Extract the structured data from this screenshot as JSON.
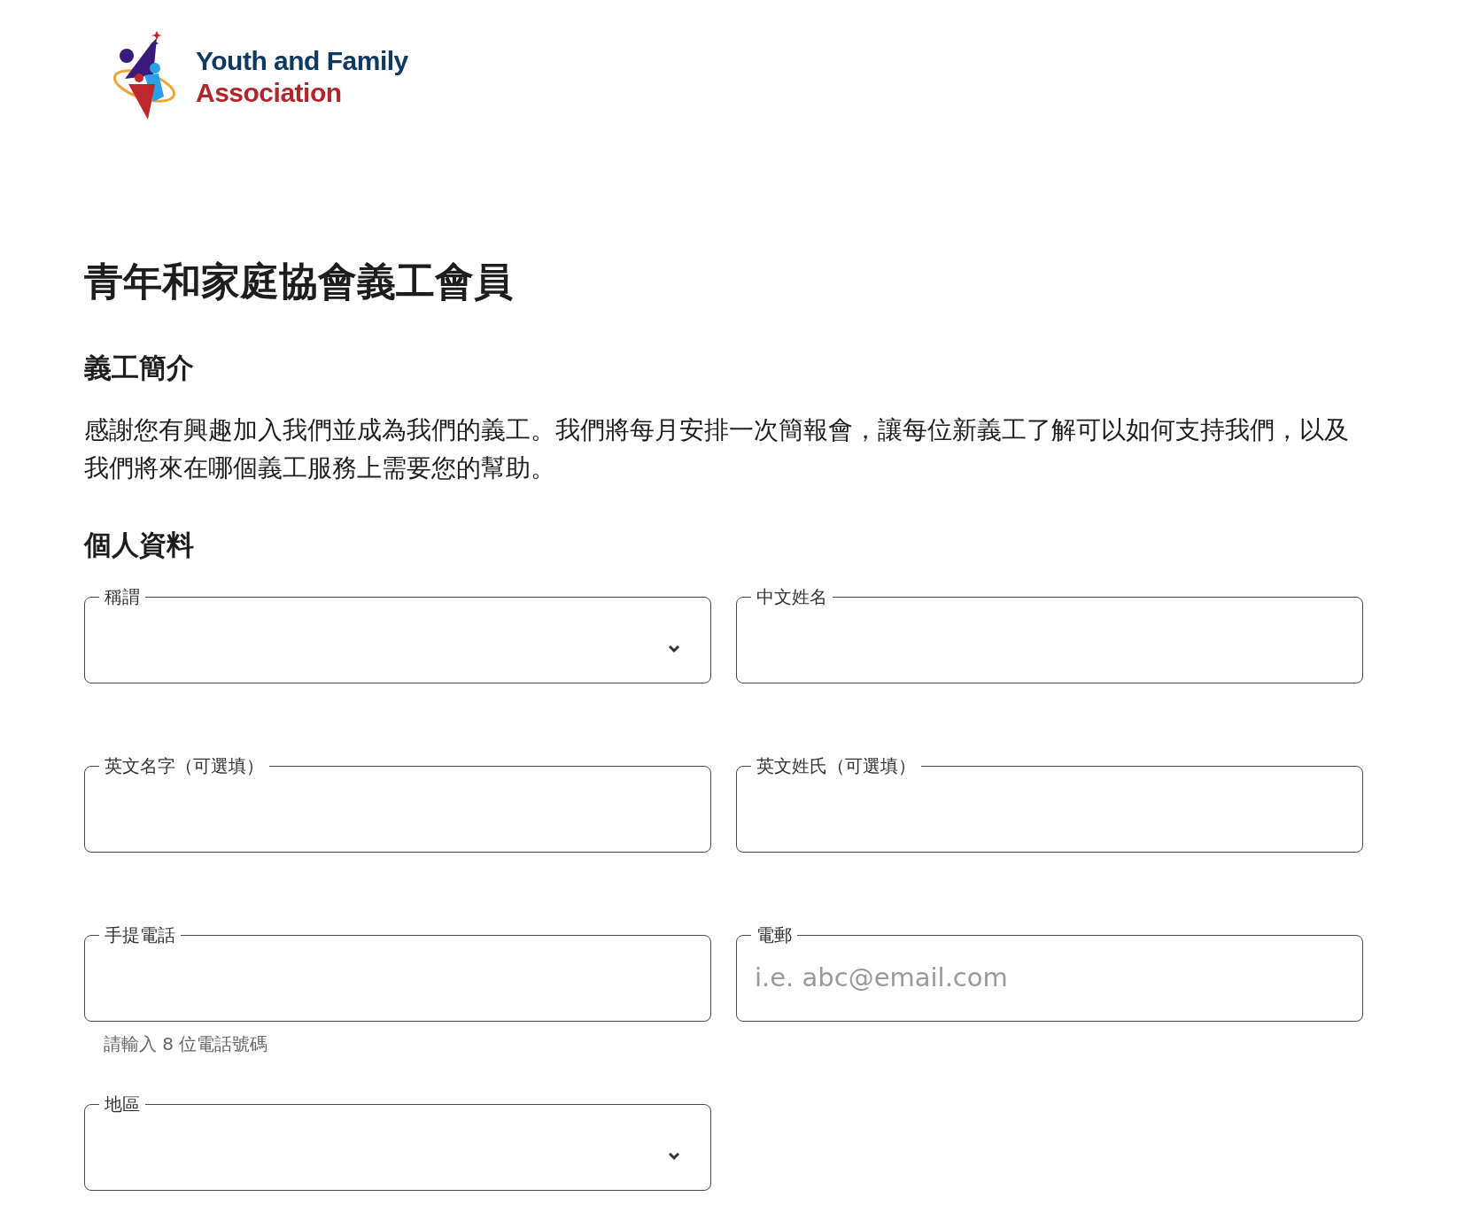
{
  "logo": {
    "line_1": "Youth and Family",
    "line_2": "Association"
  },
  "title": "青年和家庭協會義工會員",
  "intro": {
    "heading": "義工簡介",
    "text": "感謝您有興趣加入我們並成為我們的義工。我們將每月安排一次簡報會，讓每位新義工了解可以如何支持我們，以及我們將來在哪個義工服務上需要您的幫助。"
  },
  "personal": {
    "heading": "個人資料",
    "fields": [
      {
        "kind": "select",
        "label": "稱謂"
      },
      {
        "kind": "text",
        "label": "中文姓名"
      },
      {
        "kind": "text",
        "label": "英文名字（可選填）"
      },
      {
        "kind": "text",
        "label": "英文姓氏（可選填）"
      },
      {
        "kind": "text",
        "label": "手提電話",
        "hint": "請輸入 8 位電話號碼"
      },
      {
        "kind": "text",
        "label": "電郵",
        "placeholder": "i.e. abc@email.com"
      },
      {
        "kind": "select",
        "label": "地區"
      }
    ]
  }
}
